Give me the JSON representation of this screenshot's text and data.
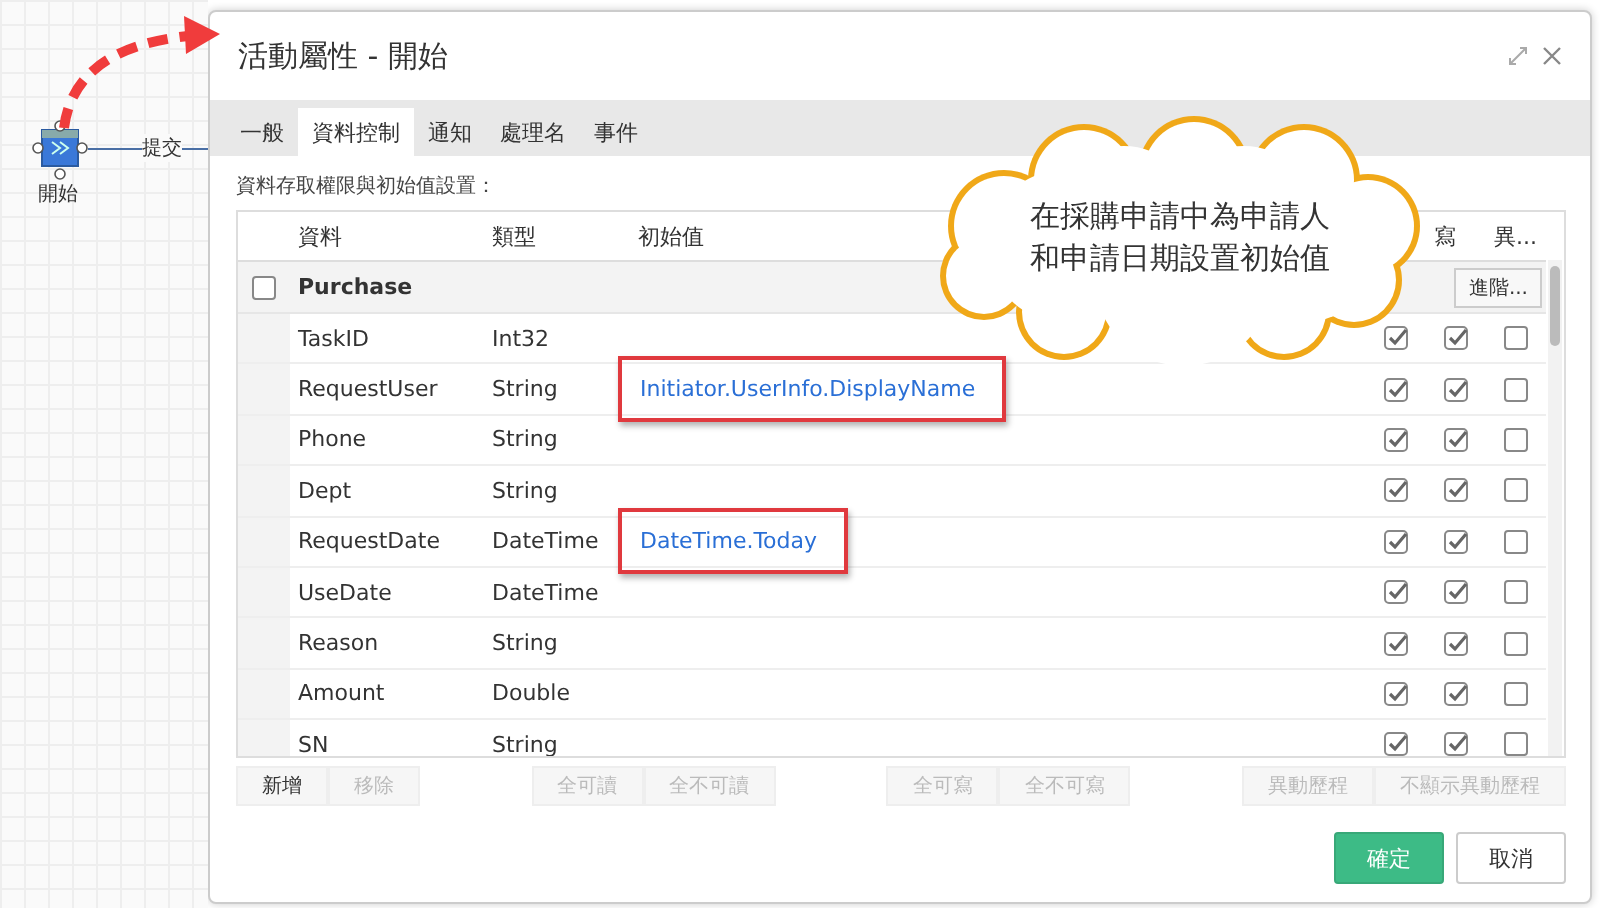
{
  "canvas": {
    "node_label": "開始",
    "connector_label": "提交"
  },
  "dialog": {
    "title": "活動屬性 - 開始",
    "tabs": [
      {
        "label": "一般",
        "selected": false
      },
      {
        "label": "資料控制",
        "selected": true
      },
      {
        "label": "通知",
        "selected": false
      },
      {
        "label": "處理名",
        "selected": false
      },
      {
        "label": "事件",
        "selected": false
      }
    ],
    "section_label": "資料存取權限與初始值設置：",
    "table": {
      "columns": [
        "資料",
        "類型",
        "初始值"
      ],
      "flag_columns": [
        "寫",
        "異..."
      ],
      "group": {
        "label": "Purchase",
        "checked": false,
        "button": "進階..."
      },
      "rows": [
        {
          "name": "TaskID",
          "type": "Int32",
          "read": true,
          "write": true,
          "diff": false
        },
        {
          "name": "RequestUser",
          "type": "String",
          "initial": "Initiator.UserInfo.DisplayName",
          "highlighted": true,
          "read": true,
          "write": true,
          "diff": false
        },
        {
          "name": "Phone",
          "type": "String",
          "read": true,
          "write": true,
          "diff": false
        },
        {
          "name": "Dept",
          "type": "String",
          "read": true,
          "write": true,
          "diff": false
        },
        {
          "name": "RequestDate",
          "type": "DateTime",
          "initial": "DateTime.Today",
          "highlighted": true,
          "read": true,
          "write": true,
          "diff": false
        },
        {
          "name": "UseDate",
          "type": "DateTime",
          "read": true,
          "write": true,
          "diff": false
        },
        {
          "name": "Reason",
          "type": "String",
          "read": true,
          "write": true,
          "diff": false
        },
        {
          "name": "Amount",
          "type": "Double",
          "read": true,
          "write": true,
          "diff": false
        },
        {
          "name": "SN",
          "type": "String",
          "read": true,
          "write": true,
          "diff": false
        }
      ]
    },
    "toolbar": [
      [
        {
          "label": "新增",
          "disabled": false
        },
        {
          "label": "移除",
          "disabled": true
        }
      ],
      [
        {
          "label": "全可讀",
          "disabled": true
        },
        {
          "label": "全不可讀",
          "disabled": true
        }
      ],
      [
        {
          "label": "全可寫",
          "disabled": true
        },
        {
          "label": "全不可寫",
          "disabled": true
        }
      ],
      [
        {
          "label": "異動歷程",
          "disabled": true
        },
        {
          "label": "不顯示異動歷程",
          "disabled": true
        }
      ]
    ],
    "ok_button": "確定",
    "cancel_button": "取消"
  },
  "callout": {
    "lines": [
      "在採購申請中為申請人",
      "和申請日期設置初始值"
    ]
  }
}
